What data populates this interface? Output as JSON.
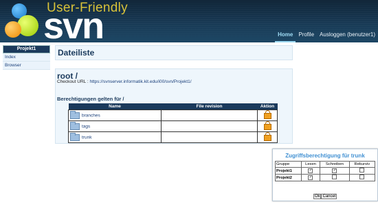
{
  "header": {
    "tagline": "User-Friendly",
    "brand": "svn",
    "nav": {
      "home": "Home",
      "profile": "Profile",
      "logout": "Ausloggen (benutzer1)"
    }
  },
  "sidebar": {
    "title": "Projekt1",
    "items": [
      {
        "label": "Index"
      },
      {
        "label": "Browser"
      }
    ]
  },
  "main": {
    "title": "Dateiliste",
    "path": "root /",
    "checkout_label": "Checkout URL :",
    "checkout_url": "https://svnserver.informatik.kit.edu/i00/svn/Projekt1/",
    "permissions_heading": "Berechtigungen gelten für /",
    "table": {
      "headers": [
        "Name",
        "File revision",
        "Aktion"
      ],
      "rows": [
        {
          "name": "branches",
          "revision": ""
        },
        {
          "name": "tags",
          "revision": ""
        },
        {
          "name": "trunk",
          "revision": ""
        }
      ]
    }
  },
  "dialog": {
    "title": "Zugriffsberechtigung für trunk",
    "headers": [
      "Gruppe",
      "Lesen",
      "Schreiben",
      "Rekursiv"
    ],
    "rows": [
      {
        "group": "Projekt1",
        "lesen": true,
        "schreiben": true,
        "rekursiv": false
      },
      {
        "group": "Projekt2",
        "lesen": true,
        "schreiben": false,
        "rekursiv": false
      }
    ],
    "ok_label": "Ok",
    "cancel_label": "Cancel"
  }
}
